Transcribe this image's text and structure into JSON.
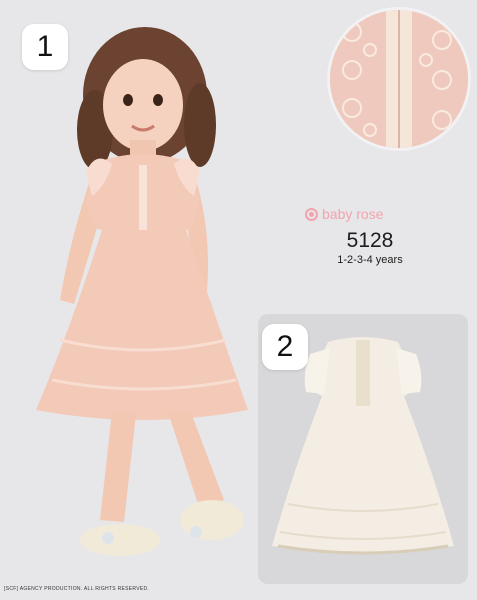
{
  "badges": {
    "first": "1",
    "second": "2"
  },
  "brand": {
    "name": "baby rose"
  },
  "product": {
    "model": "5128",
    "sizes": "1-2-3-4 years"
  },
  "footer": {
    "credit": "[SCF] AGENCY PRODUCTION. ALL RIGHTS RESERVED."
  },
  "colors": {
    "background": "#e7e7e9",
    "dress_peach": "#f3c9b8",
    "dress_cream": "#f3ede3",
    "brand_pink": "#f3a3ad"
  }
}
